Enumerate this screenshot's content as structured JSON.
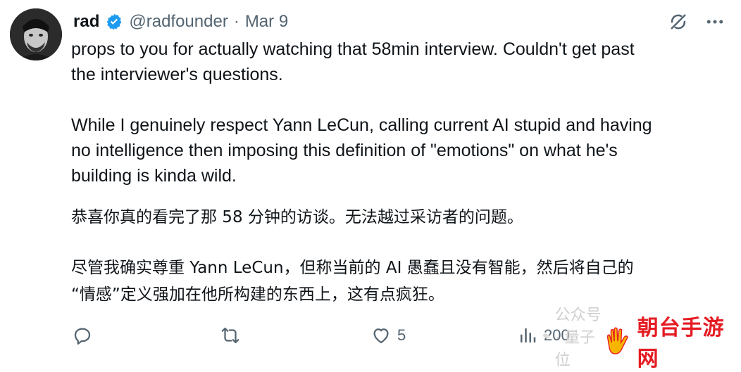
{
  "tweet": {
    "display_name": "rad",
    "handle": "@radfounder",
    "separator": "·",
    "date": "Mar 9",
    "english_paragraph_1": "props to you for actually watching that 58min interview. Couldn't get past\nthe interviewer's questions.",
    "english_paragraph_2": "While I genuinely respect Yann LeCun, calling current AI stupid and having\nno intelligence then imposing this definition of \"emotions\" on what he's\nbuilding is kinda wild.",
    "chinese_paragraph_1": "恭喜你真的看完了那 58 分钟的访谈。无法越过采访者的问题。",
    "chinese_paragraph_2": "尽管我确实尊重 Yann LeCun，但称当前的 AI 愚蠢且没有智能，然后将自己的\n“情感”定义强加在他所构建的东西上，这有点疯狂。"
  },
  "actions": {
    "replies": "",
    "reposts": "",
    "likes": "5",
    "views": "200"
  },
  "icons": {
    "verified": "verified-badge-icon",
    "grok": "grok-icon",
    "more": "more-icon",
    "reply": "reply-icon",
    "repost": "repost-icon",
    "like": "heart-icon",
    "views": "views-icon"
  },
  "watermark": {
    "left_text": "公众号 · 量子位",
    "brand_text": "朝台手游网"
  },
  "colors": {
    "verified_blue": "#1d9bf0",
    "muted": "#536471",
    "brand_red": "#e51c23"
  }
}
